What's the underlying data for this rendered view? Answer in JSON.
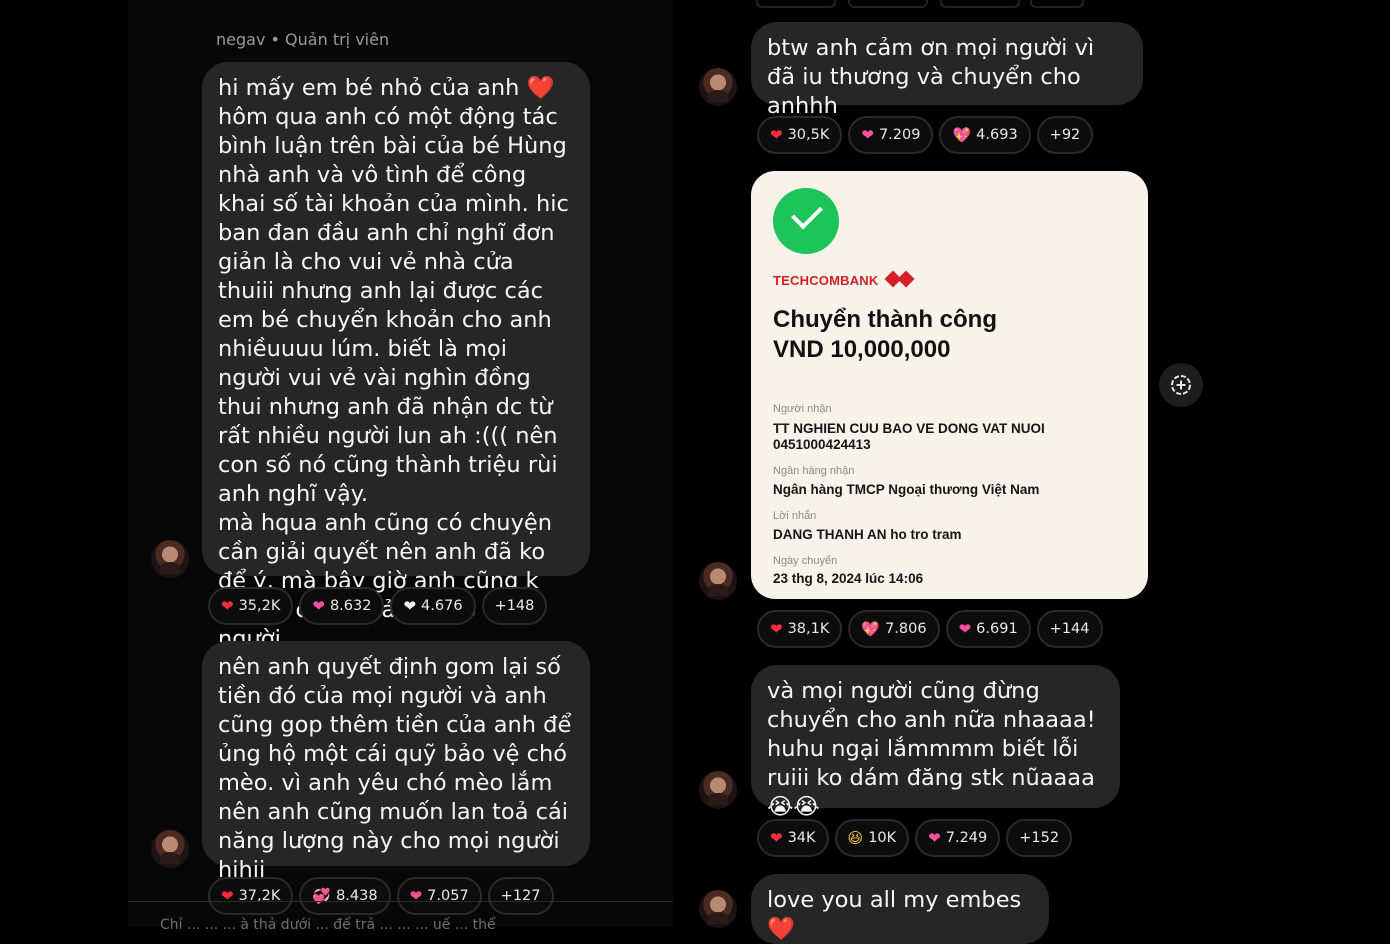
{
  "left": {
    "sender_name": "negav",
    "sender_role": "Quản trị viên",
    "messages": [
      {
        "text": "hi mấy em bé nhỏ của anh ❤️\nhôm qua anh có một động tác bình luận trên bài của bé Hùng nhà anh và vô tình để công khai số tài khoản của mình. hic ban đan đầu anh chỉ nghĩ đơn giản là cho vui vẻ nhà cửa thuiii nhưng anh lại được các em bé chuyển khoản cho anh nhiềuuuu lúm. biết là mọi người vui vẻ vài nghìn đồng thui nhưng anh đã nhận dc từ rất nhiều người lun ah :((( nên con số nó cũng thành triệu rùi anh nghĩ vậy.\nmà hqua anh cũng có chuyện cần giải quyết nên anh đã ko để ý, mà bây giờ anh cũng k biết ai ck để trả lại cho từng người.",
        "reactions": [
          {
            "icon": "heart-red",
            "glyph": "❤",
            "count": "35,2K"
          },
          {
            "icon": "heart-pink",
            "glyph": "❤",
            "count": "8.632"
          },
          {
            "icon": "heart-white",
            "glyph": "❤",
            "count": "4.676"
          },
          {
            "icon": "more",
            "glyph": "",
            "count": "+148"
          }
        ]
      },
      {
        "text": "nên anh quyết định gom lại số tiền đó của mọi người và anh cũng gop thêm tiền của anh để ủng hộ một cái quỹ bảo vệ chó mèo. vì anh yêu chó mèo lắm nên anh cũng muốn lan toả cái năng lượng này cho mọi người hihii",
        "reactions": [
          {
            "icon": "heart-red",
            "glyph": "❤",
            "count": "37,2K"
          },
          {
            "icon": "heart-gift",
            "glyph": "💞",
            "count": "8.438"
          },
          {
            "icon": "heart-pink",
            "glyph": "❤",
            "count": "7.057"
          },
          {
            "icon": "more",
            "glyph": "",
            "count": "+127"
          }
        ]
      }
    ],
    "cut_text": "Chỉ ...  ...  ... à thả dưới ... để trả ... ...  ... uế ... thể"
  },
  "right": {
    "messages": [
      {
        "text": "btw anh cảm ơn mọi người vì đã iu thương và chuyển cho anhhh",
        "reactions": [
          {
            "icon": "heart-red",
            "glyph": "❤",
            "count": "30,5K"
          },
          {
            "icon": "heart-pink",
            "glyph": "❤",
            "count": "7.209"
          },
          {
            "icon": "heart-spark",
            "glyph": "💖",
            "count": "4.693"
          },
          {
            "icon": "more",
            "glyph": "",
            "count": "+92"
          }
        ]
      },
      {
        "reactions": [
          {
            "icon": "heart-red",
            "glyph": "❤",
            "count": "38,1K"
          },
          {
            "icon": "heart-spark",
            "glyph": "💖",
            "count": "7.806"
          },
          {
            "icon": "heart-pink",
            "glyph": "❤",
            "count": "6.691"
          },
          {
            "icon": "more",
            "glyph": "",
            "count": "+144"
          }
        ]
      },
      {
        "text": "và mọi người cũng đừng chuyển cho anh nữa nhaaaa! huhu ngại lắmmmm biết lỗi ruiii ko dám đăng stk nũaaaa 😭😭",
        "reactions": [
          {
            "icon": "heart-red",
            "glyph": "❤",
            "count": "34K"
          },
          {
            "icon": "laugh-face",
            "glyph": "😆",
            "count": "10K"
          },
          {
            "icon": "heart-pink",
            "glyph": "❤",
            "count": "7.249"
          },
          {
            "icon": "more",
            "glyph": "",
            "count": "+152"
          }
        ]
      },
      {
        "text": "love you all my embes ❤️"
      }
    ]
  },
  "receipt": {
    "bank": "TECHCOMBANK",
    "title": "Chuyển thành công",
    "amount": "VND 10,000,000",
    "recipient_label": "Người nhận",
    "recipient_name": "TT NGHIEN CUU BAO VE DONG VAT NUOI",
    "recipient_account": "0451000424413",
    "bank_label": "Ngân hàng nhận",
    "bank_value": "Ngân hàng TMCP Ngoại thương Việt Nam",
    "message_label": "Lời nhắn",
    "message_value": "DANG THANH AN ho tro tram",
    "date_label": "Ngày chuyển",
    "date_value": "23 thg 8, 2024 lúc 14:06",
    "colors": {
      "success": "#1dc45a",
      "brand": "#d51f26"
    }
  },
  "add_reaction_icon": "add-reaction-icon"
}
